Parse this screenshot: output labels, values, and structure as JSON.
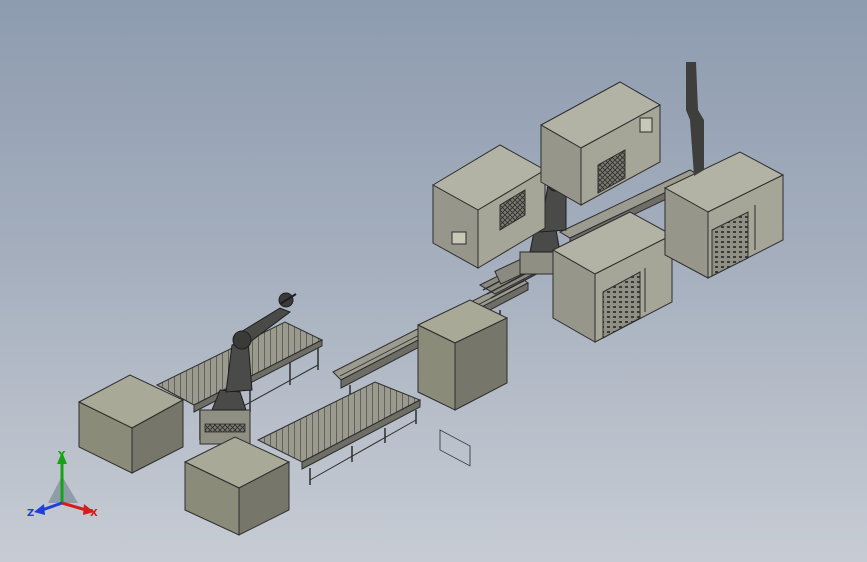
{
  "colors": {
    "box_top": "#a9a997",
    "box_left": "#8b8b7a",
    "box_right": "#76766a",
    "machine_light": "#b3b3a5",
    "machine_mid": "#96968a",
    "machine_dark": "#6e6e66",
    "line_dark": "#2d2d2d",
    "robot": "#4a4a48",
    "axis_x": "#d81b1b",
    "axis_y": "#16a316",
    "axis_z": "#1f3fd8"
  },
  "triad": {
    "x_label": "X",
    "y_label": "Y",
    "z_label": "Z"
  }
}
